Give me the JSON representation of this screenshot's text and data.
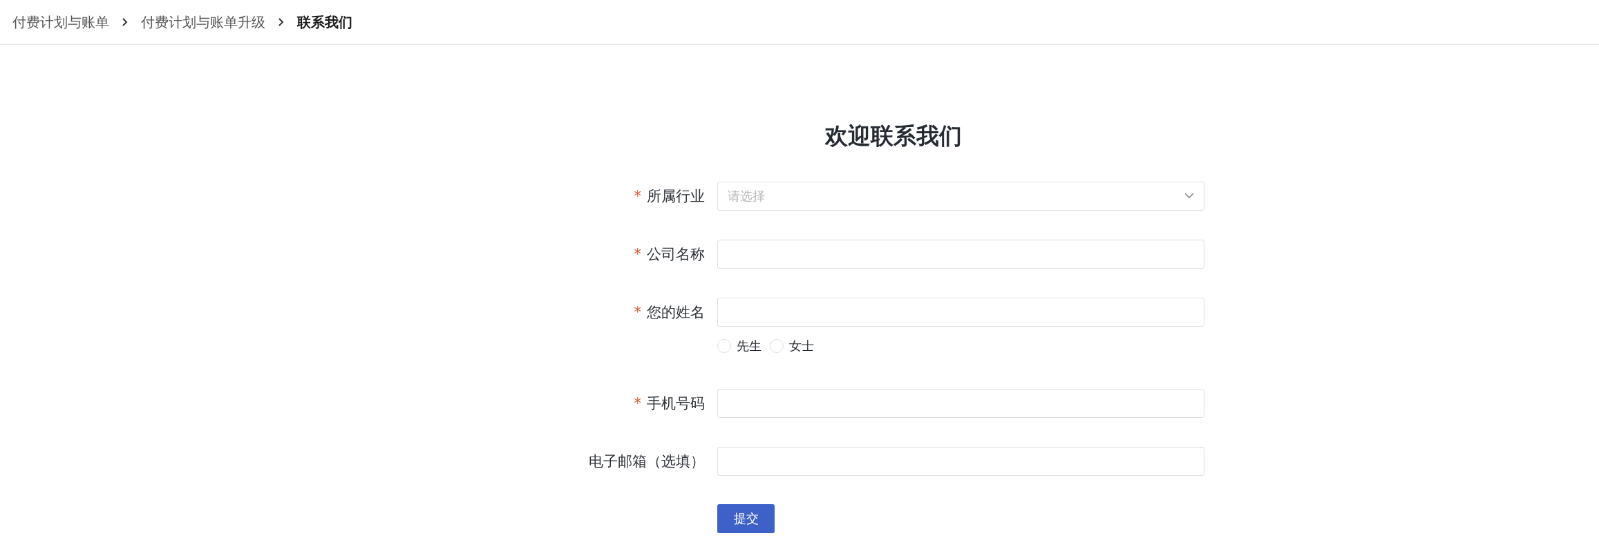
{
  "breadcrumb": [
    {
      "label": "付费计划与账单",
      "selected": false
    },
    {
      "label": "付费计划与账单升级",
      "selected": false
    },
    {
      "label": "联系我们",
      "selected": true
    }
  ],
  "title": "欢迎联系我们",
  "fields": [
    {
      "kind": "select",
      "label": "所属行业",
      "required": true,
      "placeholder": "请选择"
    },
    {
      "kind": "text",
      "label": "公司名称",
      "required": true
    },
    {
      "kind": "text",
      "label": "您的姓名",
      "required": true,
      "options": [
        {
          "label": "先生",
          "selected": false
        },
        {
          "label": "女士",
          "selected": false
        }
      ]
    },
    {
      "kind": "text",
      "label": "手机号码",
      "required": true
    },
    {
      "kind": "text",
      "label": "电子邮箱（选填）",
      "required": false
    }
  ],
  "required_mark": "*",
  "submit": "提交"
}
